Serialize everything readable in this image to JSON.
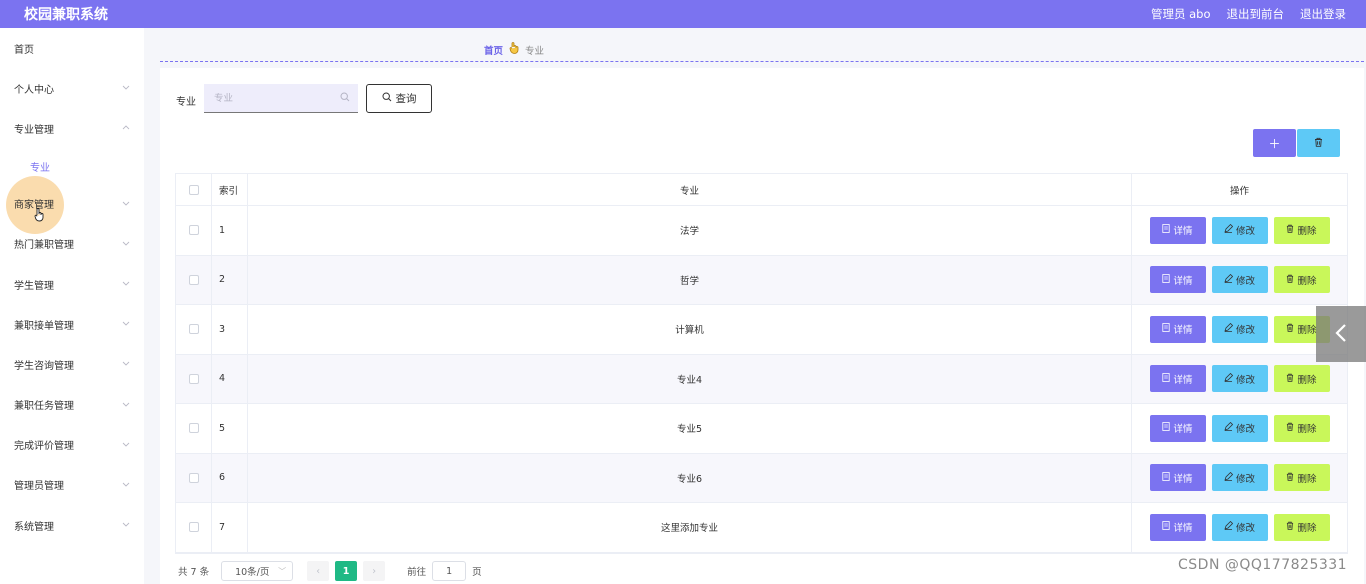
{
  "app": {
    "title": "校园兼职系统"
  },
  "topbar": {
    "user": "管理员 abo",
    "front": "退出到前台",
    "logout": "退出登录"
  },
  "sidebar": {
    "items": [
      {
        "label": "首页",
        "expandable": false
      },
      {
        "label": "个人中心",
        "expandable": true
      },
      {
        "label": "专业管理",
        "expandable": true,
        "expanded": true,
        "children": [
          "专业"
        ]
      },
      {
        "label": "商家管理",
        "expandable": true,
        "hovered": true
      },
      {
        "label": "热门兼职管理",
        "expandable": true
      },
      {
        "label": "学生管理",
        "expandable": true
      },
      {
        "label": "兼职接单管理",
        "expandable": true
      },
      {
        "label": "学生咨询管理",
        "expandable": true
      },
      {
        "label": "兼职任务管理",
        "expandable": true
      },
      {
        "label": "完成评价管理",
        "expandable": true
      },
      {
        "label": "管理员管理",
        "expandable": true
      },
      {
        "label": "系统管理",
        "expandable": true
      }
    ]
  },
  "breadcrumb": {
    "home": "首页",
    "current": "专业"
  },
  "search": {
    "label": "专业",
    "placeholder": "专业",
    "button": "查询"
  },
  "table": {
    "headers": {
      "index": "索引",
      "major": "专业",
      "ops": "操作"
    },
    "rows": [
      {
        "index": "1",
        "major": "法学"
      },
      {
        "index": "2",
        "major": "哲学"
      },
      {
        "index": "3",
        "major": "计算机"
      },
      {
        "index": "4",
        "major": "专业4"
      },
      {
        "index": "5",
        "major": "专业5"
      },
      {
        "index": "6",
        "major": "专业6"
      },
      {
        "index": "7",
        "major": "这里添加专业"
      }
    ],
    "op_labels": {
      "detail": "详情",
      "edit": "修改",
      "delete": "删除"
    }
  },
  "pagination": {
    "total": "共 7 条",
    "page_size": "10条/页",
    "current_page": "1",
    "goto_prefix": "前往",
    "goto_value": "1",
    "goto_suffix": "页"
  },
  "watermark": "CSDN @QQ177825331",
  "colors": {
    "primary": "#7b73f0",
    "info": "#5ec9f6",
    "lime": "#c9f75a",
    "green": "#1fb985"
  }
}
